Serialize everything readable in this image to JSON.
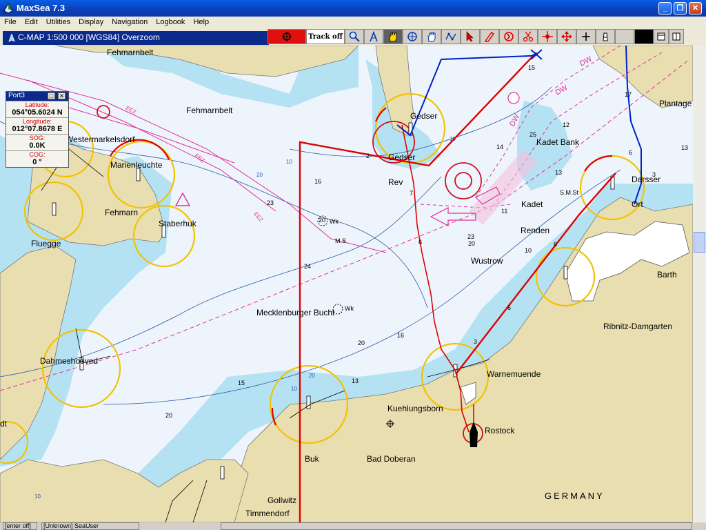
{
  "window": {
    "title": "MaxSea 7.3",
    "minimize_label": "_",
    "maximize_label": "❐",
    "close_label": "✕"
  },
  "menu": [
    "File",
    "Edit",
    "Utilities",
    "Display",
    "Navigation",
    "Logbook",
    "Help"
  ],
  "chart_bar": {
    "chart_title": "C-MAP  1:500 000 [WGS84]   Overzoom"
  },
  "toolbar": {
    "track_label": "Track off",
    "icons": [
      "zoom-icon",
      "divider-icon",
      "hand-icon",
      "crosshair-icon",
      "pan-icon",
      "route-icon",
      "cursor-icon",
      "pencil-icon",
      "undo-icon",
      "scissors-icon",
      "target-icon",
      "move-icon",
      "cross-icon",
      "beacon-icon"
    ]
  },
  "port_panel": {
    "title": "Port3",
    "latitude_label": "Latitude:",
    "latitude_value": "054°05.6024 N",
    "longitude_label": "Longitude:",
    "longitude_value": "012°07.8678 E",
    "sog_label": "SOG:",
    "sog_value": "0.0K",
    "cog_label": "COG:",
    "cog_value": "0 °"
  },
  "map": {
    "place_names": {
      "fehmarnbelt_top": "Fehmarnbelt",
      "fehmarnbelt": "Fehmarnbelt",
      "gedser": "Gedser",
      "gedser_rev": "Gedser",
      "rev": "Rev",
      "plantage": "Plantage",
      "kadet_bank": "Kadet Bank",
      "darsser": "Darsser",
      "ort": "Ort",
      "kadet": "Kadet",
      "renden": "Renden",
      "wustrow": "Wustrow",
      "barth": "Barth",
      "westermarkelsdorf": "Westermarkelsdorf",
      "marienleuchte": "Marienleuchte",
      "fehmarn": "Fehmarn",
      "staberhuk": "Staberhuk",
      "fluegge": "Fluegge",
      "mecklenburger_bucht": "Mecklenburger Bucht",
      "ribnitz": "Ribnitz-Damgarten",
      "dahmeshoeved": "Dahmeshoeved",
      "warnemuende": "Warnemuende",
      "kuehlungsborn": "Kuehlungsborn",
      "rostock": "Rostock",
      "buk": "Buk",
      "bad_doberan": "Bad Doberan",
      "gollwitz": "Gollwitz",
      "timmendorf": "Timmendorf",
      "germany": "GERMANY",
      "dt": "dt"
    },
    "labels": {
      "dw1": "DW",
      "dw2": "DW",
      "dw3": "DW",
      "ms": "M.S",
      "smst": "S.M.St",
      "eez1": "EEZ",
      "eez2": "EEZ",
      "eez3": "EEZ",
      "wk1": "Wk",
      "wk2": "Wk"
    },
    "depths": {
      "d15a": "15",
      "d17": "17",
      "d12": "12",
      "d13a": "13",
      "d25": "25",
      "d14": "14",
      "d67": "6",
      "d36": "3",
      "d131": "13",
      "d165": "16",
      "d23a": "23",
      "d71": "7",
      "d20c": "20",
      "d23b": "23",
      "d20d": "20",
      "d615": "6",
      "d106": "10",
      "d68": "6",
      "d24": "24",
      "d11": "11",
      "d6": "6",
      "d34": "3",
      "d168": "16",
      "d205": "20",
      "d13b": "13",
      "d15b": "15",
      "d20e": "20",
      "d10a": "10",
      "d10b": "10",
      "d20a": "20",
      "d20b": "20",
      "d10c": "10",
      "d10d": "10",
      "d2": "2"
    }
  },
  "status": {
    "cell1": "[enter off]",
    "cell2": "[Unknown] SeaUser"
  },
  "colors": {
    "land": "#e8deb0",
    "shallow": "#b5e2f3",
    "deep": "#eef4fb",
    "route_red": "#dd0000",
    "track_blue": "#0020c8",
    "light_sector": "#f2c200",
    "traffic_magenta": "#e0309a"
  }
}
